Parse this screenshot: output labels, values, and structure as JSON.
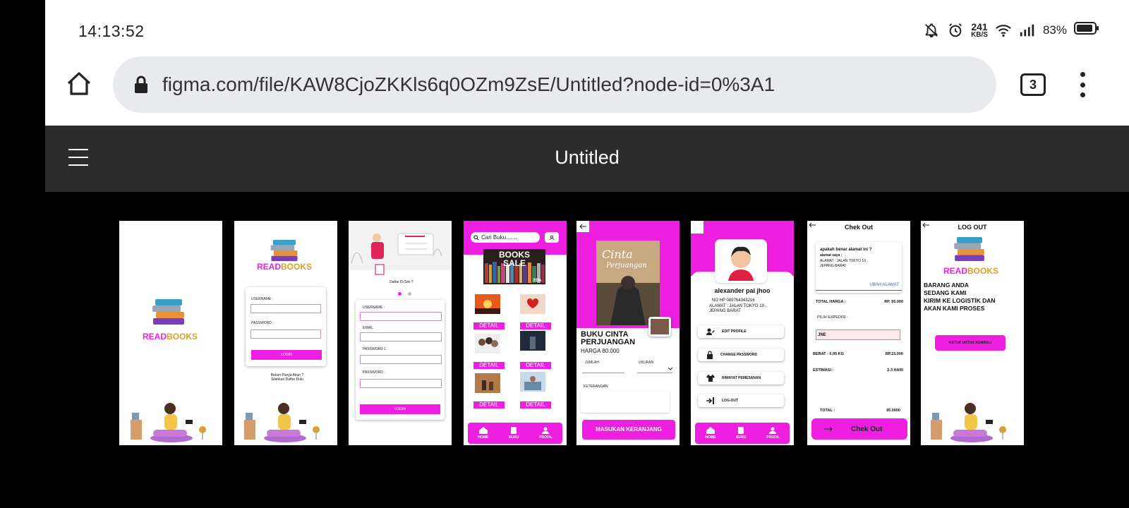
{
  "status_bar": {
    "time": "14:13:52",
    "net_speed_value": "241",
    "net_speed_unit": "KB/S",
    "battery": "83%"
  },
  "browser": {
    "url": "figma.com/file/KAW8CjoZKKls6q0OZm9ZsE/Untitled?node-id=0%3A1",
    "tab_count": "3"
  },
  "figma": {
    "document_title": "Untitled"
  },
  "frames": {
    "splash": {
      "brand_read": "READ",
      "brand_books": "BOOKS"
    },
    "login": {
      "brand_read": "READ",
      "brand_books": "BOOKS",
      "username_label": "USERNAME :",
      "password_label": "PASSWORD :",
      "login_button": "LOGIN",
      "register_hint_line1": "Belum   Punya Akun ?",
      "register_hint_line2": "Silahkan Daftar Dulu"
    },
    "register": {
      "caption": "Daftar Di Sini ?",
      "username_label": "USERNAME :",
      "email_label": "EMAIL",
      "password1_label": "PASSWORD  1 :",
      "password_label": "PASSWORD :",
      "login_button": "LOGIN"
    },
    "home": {
      "search_placeholder": "Cari Buku.......",
      "banner_line1": "BOOKS",
      "banner_line2": "SALE",
      "banner_badge": "35%",
      "detail_label": "DETAIL",
      "nav": [
        "HOME",
        "BUKU",
        "PROFIL"
      ]
    },
    "book_detail": {
      "cover_title_1": "Cinta",
      "cover_title_2": "Perjuangan",
      "title_line1": "BUKU CINTA",
      "title_line2": "PERJUANGAN",
      "price": "HARGA 80.000",
      "jumlah_label": "JUMLAH",
      "ukuran_label": "UKURAN",
      "keterangan_label": "KETERANGAN",
      "cart_button": "MASUKAN KERANJANG"
    },
    "profile": {
      "name": "alexander pai jhoo",
      "phone": "NO HP 089764343216",
      "address_line1": "ALAMAT : JALAN TOKYO 19 ,",
      "address_line2": "JEPANG BARAT",
      "menu": [
        "EDIT PROFILE",
        "CHANGE PASSWORD",
        "RIWAYAT PEMESANAN",
        "LOG-OUT"
      ],
      "nav": [
        "HOME",
        "BUKU",
        "PROFIL"
      ]
    },
    "checkout": {
      "title": "Chek Out",
      "confirm_question": "apakah benar alamat ini ?",
      "address_label": "alamat saya :",
      "address_line1": "ALAMAT : JALAN TOKYO 19 ,",
      "address_line2": "JEPANG BARAT",
      "change_address": "UBAH ALAMAT",
      "total_price_label": "TOTAL HARGA :",
      "total_price_value": "RP. 95.000",
      "expedition_label": "PILIH EXPEDISI :",
      "expedition_value": "JNE",
      "weight_label": "BERAT :  0,95 KG",
      "weight_cost": "RP.15.000",
      "estimate_label": "ESTIMASI :",
      "estimate_value": "2-3 HARI",
      "total_label": "TOTAL :",
      "total_value": "95.0000",
      "checkout_button": "Chek Out"
    },
    "logout": {
      "title": "LOG OUT",
      "brand_read": "READ",
      "brand_books": "BOOKS",
      "message_line1": "BARANG ANDA",
      "message_line2": "SEDANG KAMI",
      "message_line3": "KIRIM KE LOGISTIK DAN",
      "message_line4": "AKAN KAMI PROSES",
      "back_button": "KETUK UNTUK KEMBALI"
    }
  },
  "colors": {
    "accent_magenta": "#ee1fe0",
    "brand_gold": "#d7a12a",
    "figma_toolbar": "#2c2c2c",
    "omnibox": "#e9eaee"
  },
  "icons": [
    "home-icon",
    "lock-icon",
    "tab-switcher-icon",
    "more-vert-icon",
    "hamburger-icon",
    "bell-off-icon",
    "alarm-icon",
    "wifi-icon",
    "signal-icon",
    "battery-icon",
    "search-icon",
    "user-icon",
    "back-arrow-icon",
    "book-icon",
    "edit-profile-icon",
    "padlock-icon",
    "shirt-icon",
    "logout-icon",
    "arrow-right-icon",
    "books-stack-logo"
  ]
}
